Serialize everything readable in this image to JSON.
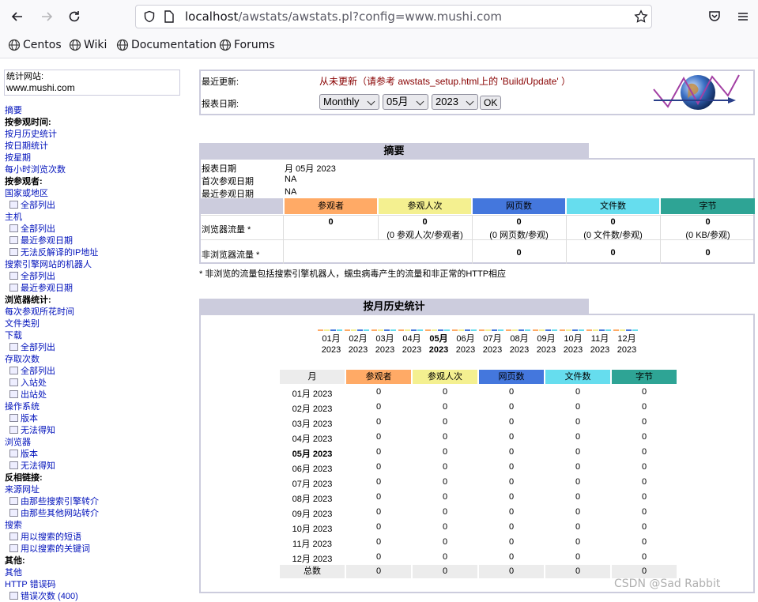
{
  "browser": {
    "url_host": "localhost",
    "url_path": "/awstats/awstats.pl?config=www.mushi.com",
    "bookmarks": [
      "Centos",
      "Wiki",
      "Documentation",
      "Forums"
    ]
  },
  "sidebar": {
    "site_label": "统计网站:",
    "site_value": "www.mushi.com",
    "items": [
      {
        "text": "摘要",
        "kind": "link"
      },
      {
        "text": "按参观时间:",
        "kind": "head"
      },
      {
        "text": "按月历史统计",
        "kind": "link"
      },
      {
        "text": "按日期统计",
        "kind": "link"
      },
      {
        "text": "按星期",
        "kind": "link"
      },
      {
        "text": "每小时浏览次数",
        "kind": "link"
      },
      {
        "text": "按参观者:",
        "kind": "head"
      },
      {
        "text": "国家或地区",
        "kind": "link"
      },
      {
        "text": "全部列出",
        "kind": "sub"
      },
      {
        "text": "主机",
        "kind": "link"
      },
      {
        "text": "全部列出",
        "kind": "sub"
      },
      {
        "text": "最近参观日期",
        "kind": "sub"
      },
      {
        "text": "无法反解译的IP地址",
        "kind": "sub"
      },
      {
        "text": "搜索引擎网站的机器人",
        "kind": "link"
      },
      {
        "text": "全部列出",
        "kind": "sub"
      },
      {
        "text": "最近参观日期",
        "kind": "sub"
      },
      {
        "text": "浏览器统计:",
        "kind": "head"
      },
      {
        "text": "每次参观所花时间",
        "kind": "link"
      },
      {
        "text": "文件类别",
        "kind": "link"
      },
      {
        "text": "下载",
        "kind": "link"
      },
      {
        "text": "全部列出",
        "kind": "sub"
      },
      {
        "text": "存取次数",
        "kind": "link"
      },
      {
        "text": "全部列出",
        "kind": "sub"
      },
      {
        "text": "入站处",
        "kind": "sub"
      },
      {
        "text": "出站处",
        "kind": "sub"
      },
      {
        "text": "操作系统",
        "kind": "link"
      },
      {
        "text": "版本",
        "kind": "sub"
      },
      {
        "text": "无法得知",
        "kind": "sub"
      },
      {
        "text": "浏览器",
        "kind": "link"
      },
      {
        "text": "版本",
        "kind": "sub"
      },
      {
        "text": "无法得知",
        "kind": "sub"
      },
      {
        "text": "反相链接:",
        "kind": "head"
      },
      {
        "text": "来源网址",
        "kind": "link"
      },
      {
        "text": "由那些搜索引擎转介",
        "kind": "sub"
      },
      {
        "text": "由那些其他网站转介",
        "kind": "sub"
      },
      {
        "text": "搜索",
        "kind": "link"
      },
      {
        "text": "用以搜索的短语",
        "kind": "sub"
      },
      {
        "text": "用以搜索的关键词",
        "kind": "sub"
      },
      {
        "text": "其他:",
        "kind": "head"
      },
      {
        "text": "其他",
        "kind": "link"
      },
      {
        "text": "HTTP 错误码",
        "kind": "link"
      },
      {
        "text": "错误次数 (400)",
        "kind": "sub"
      }
    ]
  },
  "update": {
    "last_update_label": "最近更新:",
    "last_update_prefix": "从未更新（请参考 ",
    "last_update_link": "awstats_setup.html",
    "last_update_suffix": "上的 'Build/Update' ）",
    "report_date_label": "报表日期:",
    "period_select": "Monthly",
    "month_select": "05月",
    "year_select": "2023",
    "ok_label": "OK"
  },
  "summary": {
    "title": "摘要",
    "report_period_label": "报表日期",
    "report_period_value": "月 05月 2023",
    "first_visit_label": "首次参观日期",
    "first_visit_value": "NA",
    "last_visit_label": "最近参观日期",
    "last_visit_value": "NA",
    "columns": [
      "参观者",
      "参观人次",
      "网页数",
      "文件数",
      "字节"
    ],
    "viewed_label": "浏览器流量 *",
    "viewed": {
      "visitors": "0",
      "visits": "0",
      "visits_sub": "(0 参观人次/参观者)",
      "pages": "0",
      "pages_sub": "(0 网页数/参观)",
      "hits": "0",
      "hits_sub": "(0 文件数/参观)",
      "bytes": "0",
      "bytes_sub": "(0 KB/参观)"
    },
    "notviewed_label": "非浏览器流量 *",
    "notviewed": {
      "pages": "0",
      "hits": "0",
      "bytes": "0"
    },
    "footnote": "* 非浏览的流量包括搜索引擎机器人，蠕虫病毒产生的流量和非正常的HTTP相应"
  },
  "monthly": {
    "title": "按月历史统计",
    "months": [
      {
        "m": "01月",
        "y": "2023",
        "current": false
      },
      {
        "m": "02月",
        "y": "2023",
        "current": false
      },
      {
        "m": "03月",
        "y": "2023",
        "current": false
      },
      {
        "m": "04月",
        "y": "2023",
        "current": false
      },
      {
        "m": "05月",
        "y": "2023",
        "current": true
      },
      {
        "m": "06月",
        "y": "2023",
        "current": false
      },
      {
        "m": "07月",
        "y": "2023",
        "current": false
      },
      {
        "m": "08月",
        "y": "2023",
        "current": false
      },
      {
        "m": "09月",
        "y": "2023",
        "current": false
      },
      {
        "m": "10月",
        "y": "2023",
        "current": false
      },
      {
        "m": "11月",
        "y": "2023",
        "current": false
      },
      {
        "m": "12月",
        "y": "2023",
        "current": false
      }
    ],
    "columns": [
      "月",
      "参观者",
      "参观人次",
      "网页数",
      "文件数",
      "字节"
    ],
    "rows": [
      {
        "month": "01月 2023",
        "current": false,
        "vals": [
          "0",
          "0",
          "0",
          "0",
          "0"
        ]
      },
      {
        "month": "02月 2023",
        "current": false,
        "vals": [
          "0",
          "0",
          "0",
          "0",
          "0"
        ]
      },
      {
        "month": "03月 2023",
        "current": false,
        "vals": [
          "0",
          "0",
          "0",
          "0",
          "0"
        ]
      },
      {
        "month": "04月 2023",
        "current": false,
        "vals": [
          "0",
          "0",
          "0",
          "0",
          "0"
        ]
      },
      {
        "month": "05月 2023",
        "current": true,
        "vals": [
          "0",
          "0",
          "0",
          "0",
          "0"
        ]
      },
      {
        "month": "06月 2023",
        "current": false,
        "vals": [
          "0",
          "0",
          "0",
          "0",
          "0"
        ]
      },
      {
        "month": "07月 2023",
        "current": false,
        "vals": [
          "0",
          "0",
          "0",
          "0",
          "0"
        ]
      },
      {
        "month": "08月 2023",
        "current": false,
        "vals": [
          "0",
          "0",
          "0",
          "0",
          "0"
        ]
      },
      {
        "month": "09月 2023",
        "current": false,
        "vals": [
          "0",
          "0",
          "0",
          "0",
          "0"
        ]
      },
      {
        "month": "10月 2023",
        "current": false,
        "vals": [
          "0",
          "0",
          "0",
          "0",
          "0"
        ]
      },
      {
        "month": "11月 2023",
        "current": false,
        "vals": [
          "0",
          "0",
          "0",
          "0",
          "0"
        ]
      },
      {
        "month": "12月 2023",
        "current": false,
        "vals": [
          "0",
          "0",
          "0",
          "0",
          "0"
        ]
      }
    ],
    "total_label": "总数",
    "total_vals": [
      "0",
      "0",
      "0",
      "0",
      "0"
    ]
  },
  "watermark": "CSDN @Sad Rabbit",
  "colors": {
    "visitors": "#ffaa66",
    "visits": "#f4f090",
    "pages": "#4477dd",
    "hits": "#66ddee",
    "bytes": "#2ea495",
    "section_bg": "#ccccdd"
  }
}
